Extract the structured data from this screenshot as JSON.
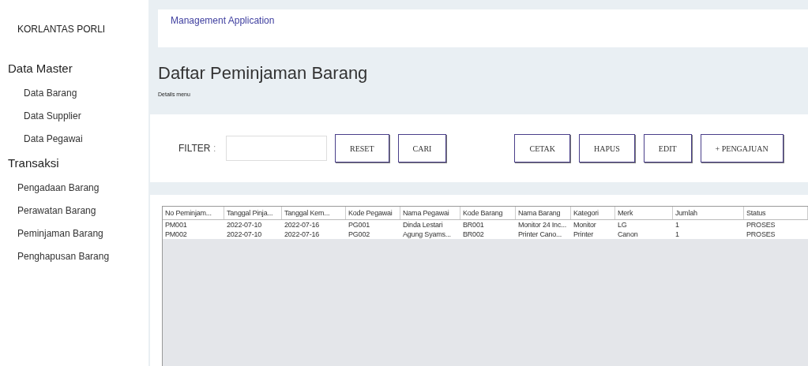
{
  "sidebar": {
    "brand": "KORLANTAS PORLI",
    "sections": [
      {
        "title": "Data Master",
        "items": [
          {
            "label": "Data Barang"
          },
          {
            "label": "Data Supplier"
          },
          {
            "label": "Data Pegawai"
          }
        ]
      },
      {
        "title": "Transaksi",
        "items": [
          {
            "label": "Pengadaan Barang"
          },
          {
            "label": "Perawatan Barang"
          },
          {
            "label": "Peminjaman Barang"
          },
          {
            "label": "Penghapusan Barang"
          }
        ]
      }
    ]
  },
  "header": {
    "title": "Management Application"
  },
  "page": {
    "title": "Daftar Peminjaman Barang",
    "subtitle": "Details menu"
  },
  "filter": {
    "label": "FILTER",
    "separator": ":",
    "buttons": [
      "RESET",
      "CARI"
    ],
    "actions": [
      "CETAK",
      "HAPUS",
      "EDIT",
      "+ PENGAJUAN"
    ]
  },
  "table": {
    "columns": [
      "No Peminjam...",
      "Tanggal Pinja...",
      "Tanggal Kem...",
      "Kode Pegawai",
      "Nama Pegawai",
      "Kode Barang",
      "Nama Barang",
      "Kategori",
      "Merk",
      "Jumlah",
      "Status"
    ],
    "rows": [
      [
        "PM001",
        "2022-07-10",
        "2022-07-16",
        "PG001",
        "Dinda Lestari",
        "BR001",
        "Monitor 24 Inc...",
        "Monitor",
        "LG",
        "1",
        "PROSES"
      ],
      [
        "PM002",
        "2022-07-10",
        "2022-07-16",
        "PG002",
        "Agung Syams...",
        "BR002",
        "Printer Cano...",
        "Printer",
        "Canon",
        "1",
        "PROSES"
      ]
    ]
  }
}
